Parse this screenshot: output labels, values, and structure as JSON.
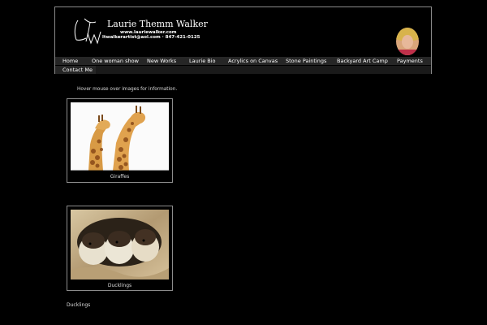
{
  "site": {
    "name": "Laurie Themm Walker",
    "url": "www.lauriewalker.com",
    "contact": "ltwalkerartist@aol.com · 847-421-0125",
    "monogram": "LTW"
  },
  "nav": {
    "items": [
      {
        "label": "Home"
      },
      {
        "label": "One woman show"
      },
      {
        "label": "New Works"
      },
      {
        "label": "Laurie Bio"
      },
      {
        "label": "Acrylics on Canvas"
      },
      {
        "label": "Stone Paintings"
      },
      {
        "label": "Backyard Art Camp"
      },
      {
        "label": "Payments"
      },
      {
        "label": "Contact Me"
      }
    ]
  },
  "gallery": {
    "hint": "Hover mouse over images for information.",
    "items": [
      {
        "caption": "Giraffes"
      },
      {
        "caption": "Ducklings"
      }
    ],
    "bottom_caption": "Ducklings"
  }
}
